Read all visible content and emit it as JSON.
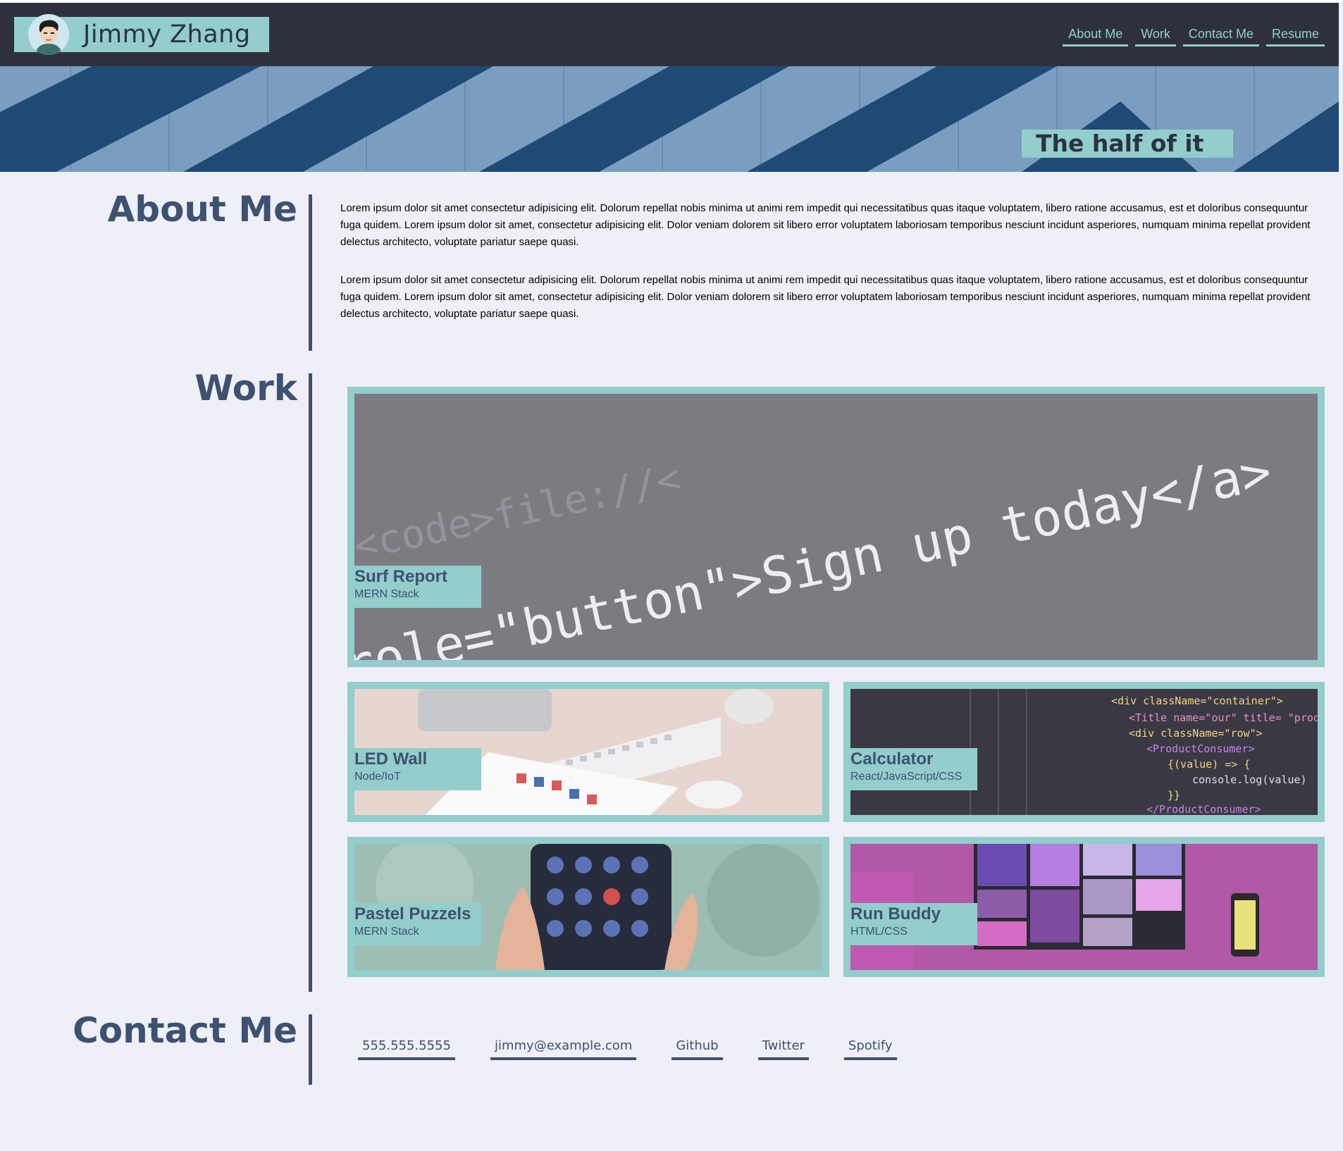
{
  "header": {
    "brand_name": "Jimmy Zhang",
    "nav": [
      "About Me",
      "Work",
      "Contact Me",
      "Resume"
    ]
  },
  "hero": {
    "tagline": "The half of it"
  },
  "about": {
    "title": "About Me",
    "paragraphs": [
      "Lorem ipsum dolor sit amet consectetur adipisicing elit. Dolorum repellat nobis minima ut animi rem impedit qui necessitatibus quas itaque voluptatem, libero ratione accusamus, est et doloribus consequuntur fuga quidem. Lorem ipsum dolor sit amet, consectetur adipisicing elit. Dolor veniam dolorem sit libero error voluptatem laboriosam temporibus nesciunt incidunt asperiores, numquam minima repellat provident delectus architecto, voluptate pariatur saepe quasi.",
      "Lorem ipsum dolor sit amet consectetur adipisicing elit. Dolorum repellat nobis minima ut animi rem impedit qui necessitatibus quas itaque voluptatem, libero ratione accusamus, est et doloribus consequuntur fuga quidem. Lorem ipsum dolor sit amet, consectetur adipisicing elit. Dolor veniam dolorem sit libero error voluptatem laboriosam temporibus nesciunt incidunt asperiores, numquam minima repellat provident delectus architecto, voluptate pariatur saepe quasi."
    ]
  },
  "work": {
    "title": "Work",
    "projects": [
      {
        "title": "Surf Report",
        "stack": "MERN Stack",
        "image_text": [
          "<code>file://<",
          "role=\"button\">Sign up today</a>"
        ]
      },
      {
        "title": "LED Wall",
        "stack": "Node/IoT"
      },
      {
        "title": "Calculator",
        "stack": "React/JavaScript/CSS"
      },
      {
        "title": "Pastel Puzzels",
        "stack": "MERN Stack"
      },
      {
        "title": "Run Buddy",
        "stack": "HTML/CSS"
      }
    ]
  },
  "contact": {
    "title": "Contact Me",
    "links": [
      "555.555.5555",
      "jimmy@example.com",
      "Github",
      "Twitter",
      "Spotify"
    ]
  },
  "colors": {
    "accent": "#93cdcc",
    "header_bg": "#2e313d",
    "heading": "#3d5170",
    "page_bg": "#efeff7"
  }
}
